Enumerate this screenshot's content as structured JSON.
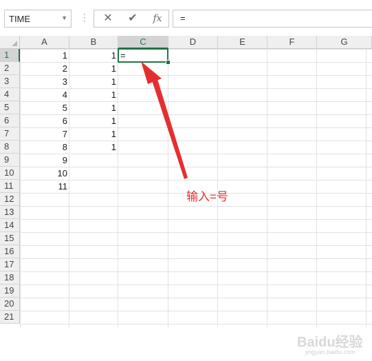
{
  "name_box": {
    "value": "TIME",
    "dropdown_icon": "chevron-down-icon"
  },
  "formula_bar": {
    "cancel_icon": "✕",
    "enter_icon": "✔",
    "function_icon": "fx",
    "content": "="
  },
  "columns": [
    "A",
    "B",
    "C",
    "D",
    "E",
    "F",
    "G"
  ],
  "active_column": "C",
  "rows": [
    "1",
    "2",
    "3",
    "4",
    "5",
    "6",
    "7",
    "8",
    "9",
    "10",
    "11",
    "12",
    "13",
    "14",
    "15",
    "16",
    "17",
    "18",
    "19",
    "20",
    "21"
  ],
  "active_row": "1",
  "cells": {
    "A": [
      "1",
      "2",
      "3",
      "4",
      "5",
      "6",
      "7",
      "8",
      "9",
      "10",
      "11"
    ],
    "B": [
      "1",
      "1",
      "1",
      "1",
      "1",
      "1",
      "1",
      "1"
    ],
    "C1": "="
  },
  "annotation": {
    "text": "输入=号",
    "color": "#e52e2e"
  },
  "watermark": {
    "text": "Baidu经验",
    "sub": "jingyan.baidu.com"
  },
  "colors": {
    "accent": "#217346",
    "annotation": "#e52e2e"
  }
}
